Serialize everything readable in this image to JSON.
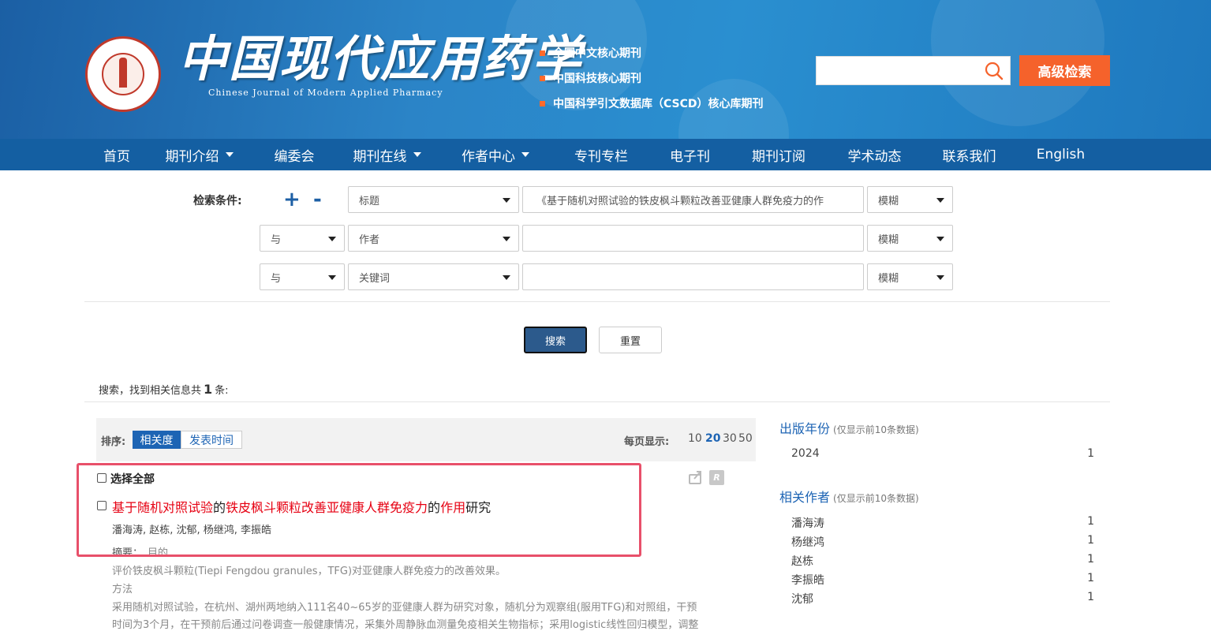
{
  "header": {
    "logo_cn": "中国现代应用药学",
    "logo_en": "Chinese Journal of Modern Applied Pharmacy",
    "seal_text": "中国现代应用药学 · Chinese Journal of Modern Applied Pharmacy",
    "badges": [
      "全国中文核心期刊",
      "中国科技核心期刊",
      "中国科学引文数据库（CSCD）核心库期刊"
    ],
    "search_placeholder": "",
    "advanced_search": "高级检索",
    "accent_color": "#f5622b"
  },
  "nav": {
    "items": [
      {
        "label": "首页",
        "dropdown": false
      },
      {
        "label": "期刊介绍",
        "dropdown": true
      },
      {
        "label": "编委会",
        "dropdown": false
      },
      {
        "label": "期刊在线",
        "dropdown": true
      },
      {
        "label": "作者中心",
        "dropdown": true
      },
      {
        "label": "专刊专栏",
        "dropdown": false
      },
      {
        "label": "电子刊",
        "dropdown": false
      },
      {
        "label": "期刊订阅",
        "dropdown": false
      },
      {
        "label": "学术动态",
        "dropdown": false
      },
      {
        "label": "联系我们",
        "dropdown": false
      },
      {
        "label": "English",
        "dropdown": false
      }
    ]
  },
  "form": {
    "label": "检索条件:",
    "plus": "+",
    "minus": "-",
    "rows": [
      {
        "logic": "",
        "field": "标题",
        "value": "《基于随机对照试验的铁皮枫斗颗粒改善亚健康人群免疫力的作",
        "match": "模糊"
      },
      {
        "logic": "与",
        "field": "作者",
        "value": "",
        "match": "模糊"
      },
      {
        "logic": "与",
        "field": "关键词",
        "value": "",
        "match": "模糊"
      }
    ],
    "search_button": "搜索",
    "reset_button": "重置"
  },
  "summary": {
    "prefix": "搜索，找到相关信息共",
    "count": "1",
    "suffix": "条:"
  },
  "sortbar": {
    "label": "排序:",
    "options": [
      "相关度",
      "发表时间"
    ],
    "active": "相关度",
    "perpage_label": "每页显示:",
    "perpage_options": [
      "10",
      "20",
      "30",
      "50"
    ],
    "perpage_active": "20"
  },
  "results": {
    "select_all": "选择全部",
    "r_icon_letter": "R",
    "items": [
      {
        "title_parts": [
          {
            "text": "基于随机对照试验",
            "hl": true
          },
          {
            "text": "的",
            "hl": false
          },
          {
            "text": "铁皮枫斗颗粒改善亚健康人群免疫力",
            "hl": true
          },
          {
            "text": "的",
            "hl": false
          },
          {
            "text": "作用",
            "hl": true
          },
          {
            "text": "研究",
            "hl": false
          }
        ],
        "authors": "潘海涛, 赵栋, 沈郁, 杨继鸿, 李振皓",
        "abstract_label": "摘要：",
        "abstract_lines": [
          "目的",
          "评价铁皮枫斗颗粒(Tiepi Fengdou granules，TFG)对亚健康人群免疫力的改善效果。",
          "方法",
          "采用随机对照试验，在杭州、湖州两地纳入111名40~65岁的亚健康人群为研究对象，随机分为观察组(服用TFG)和对照组，干预",
          "时间为3个月，在干预前后通过问卷调查一般健康情况，采集外周静脉血测量免疫相关生物指标；采用logistic线性回归模型，调整"
        ]
      }
    ]
  },
  "sidebar": {
    "year_title": "出版年份",
    "year_note": "(仅显示前10条数据)",
    "years": [
      {
        "label": "2024",
        "count": "1"
      }
    ],
    "author_title": "相关作者",
    "author_note": "(仅显示前10条数据)",
    "authors": [
      {
        "label": "潘海涛",
        "count": "1"
      },
      {
        "label": "杨继鸿",
        "count": "1"
      },
      {
        "label": "赵栋",
        "count": "1"
      },
      {
        "label": "李振皓",
        "count": "1"
      },
      {
        "label": "沈郁",
        "count": "1"
      }
    ]
  }
}
